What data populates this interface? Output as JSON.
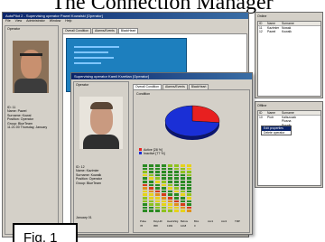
{
  "page": {
    "title": "The Connection Manager",
    "figure_label": "Fig. 1"
  },
  "main_window": {
    "title": "AutoPilot 2 - Supervising operator Pawel Kowalski [Operator]",
    "menu": [
      "File",
      "View",
      "Administrator",
      "Window",
      "Help"
    ],
    "operator_panel_label": "Operator",
    "tabs": [
      "Overall Condition",
      "Alarms/Events",
      "BlackHeart"
    ],
    "info": [
      "ID: 11",
      "Name: Pawel",
      "Surname: Kowal",
      "Position: Operator",
      "Group: BlueTeam",
      "11:21:00  Thursday, January"
    ]
  },
  "online": {
    "label": "Online",
    "columns": [
      "ID",
      "Name",
      "Surname"
    ],
    "rows": [
      {
        "id": "11",
        "name": "Kazimier",
        "surname": "Nowak"
      },
      {
        "id": "12",
        "name": "Pawel",
        "surname": "Kowalk"
      }
    ]
  },
  "offline": {
    "label": "Offline",
    "columns": [
      "ID",
      "Name",
      "Surname"
    ],
    "rows": [
      {
        "id": "10",
        "name": "Piotr",
        "surname": "Kaliszczak"
      },
      {
        "id": "",
        "name": "",
        "surname": "Plusna"
      },
      {
        "id": "",
        "name": "",
        "surname": "Pusnik"
      }
    ],
    "context_menu": [
      "Edit properties",
      "Delete operator"
    ]
  },
  "second_window": {
    "title": "Supervising operator Kamil Krzetlan [Operator]",
    "operator_panel_label": "Operator",
    "tabs": [
      "Overall Condition",
      "Alarms/Events",
      "BlackHeart"
    ],
    "condition_label": "Condition",
    "info": [
      "ID: 12",
      "Name: Kazimier",
      "Surname: Kowalk",
      "Position: Operator",
      "Group: BlueTeam",
      "January 01"
    ],
    "bar_labels": [
      "Pulse",
      "Day.Hill",
      "HeartsSig",
      "Before",
      "BAL",
      "Acc1",
      "Acc2",
      "TMP"
    ],
    "bar_values": [
      "78",
      "958",
      "1382",
      "1218",
      "0",
      "",
      "",
      ""
    ]
  },
  "chart_data": {
    "type": "pie",
    "title": "",
    "labels": [
      "Active [28 %]",
      "Inactive [77 %]"
    ],
    "values": [
      28,
      77
    ],
    "colors": [
      "#e82020",
      "#1a2fd6"
    ],
    "legend": "bottom-left"
  },
  "colors": {
    "accent": "#0a246a",
    "chart_bg": "#1d7fbe",
    "active": "#e82020",
    "inactive": "#1a2fd6"
  }
}
